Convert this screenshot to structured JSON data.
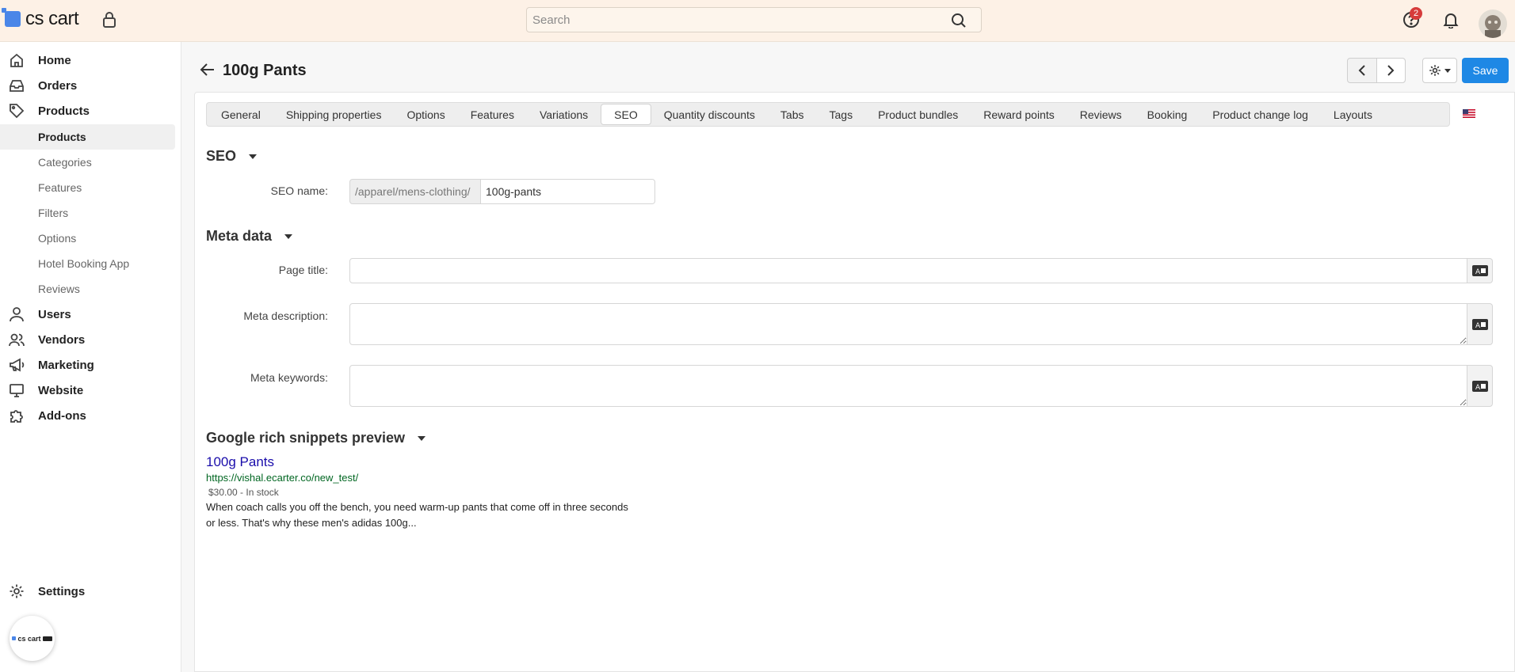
{
  "header": {
    "logo_text": "cs cart",
    "search_placeholder": "Search",
    "help_badge": "2"
  },
  "sidebar": {
    "items": [
      {
        "label": "Home",
        "icon": "home-icon"
      },
      {
        "label": "Orders",
        "icon": "inbox-icon"
      },
      {
        "label": "Products",
        "icon": "tag-icon"
      },
      {
        "label": "Users",
        "icon": "user-icon"
      },
      {
        "label": "Vendors",
        "icon": "users-icon"
      },
      {
        "label": "Marketing",
        "icon": "megaphone-icon"
      },
      {
        "label": "Website",
        "icon": "monitor-icon"
      },
      {
        "label": "Add-ons",
        "icon": "puzzle-icon"
      }
    ],
    "products_sub": [
      "Products",
      "Categories",
      "Features",
      "Filters",
      "Options",
      "Hotel Booking App",
      "Reviews"
    ],
    "settings": "Settings",
    "bubble_text": "cs cart"
  },
  "page": {
    "title": "100g Pants",
    "save_label": "Save",
    "tabs": [
      "General",
      "Shipping properties",
      "Options",
      "Features",
      "Variations",
      "SEO",
      "Quantity discounts",
      "Tabs",
      "Tags",
      "Product bundles",
      "Reward points",
      "Reviews",
      "Booking",
      "Product change log",
      "Layouts"
    ],
    "active_tab": "SEO"
  },
  "seo": {
    "heading": "SEO",
    "name_label": "SEO name:",
    "prefix": "/apparel/mens-clothing/",
    "name_value": "100g-pants"
  },
  "meta": {
    "heading": "Meta data",
    "page_title_label": "Page title:",
    "page_title_value": "",
    "description_label": "Meta description:",
    "description_value": "",
    "keywords_label": "Meta keywords:",
    "keywords_value": ""
  },
  "snippet": {
    "heading": "Google rich snippets preview",
    "title": "100g Pants",
    "url": "https://vishal.ecarter.co/new_test/",
    "price_stock": "$30.00 - In stock",
    "description": "When coach calls you off the bench, you need warm-up pants that come off in three seconds or less. That's why these men's adidas 100g..."
  },
  "colors": {
    "accent": "#1e88e5",
    "topbar": "#fdf1e6",
    "snippet_link": "#1a0dab",
    "snippet_url": "#006621"
  }
}
